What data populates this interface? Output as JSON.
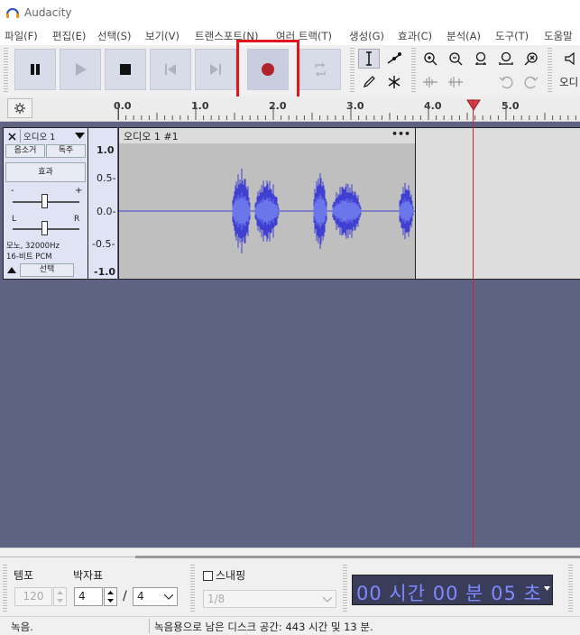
{
  "window": {
    "title": "Audacity"
  },
  "menu": [
    "파일(F)",
    "편집(E)",
    "선택(S)",
    "보기(V)",
    "트랜스포트(N)",
    "여러 트랙(T)",
    "생성(G)",
    "효과(C)",
    "분석(A)",
    "도구(T)",
    "도움말"
  ],
  "toolbar": {
    "transport": [
      {
        "name": "pause",
        "enabled": true
      },
      {
        "name": "play",
        "enabled": false
      },
      {
        "name": "stop",
        "enabled": true
      },
      {
        "name": "skip-to-start",
        "enabled": false
      },
      {
        "name": "skip-to-end",
        "enabled": false
      },
      {
        "name": "record",
        "enabled": true,
        "highlighted": true
      },
      {
        "name": "loop",
        "enabled": false
      }
    ],
    "right_label": "오디"
  },
  "timeline": {
    "labels": [
      "0.0",
      "1.0",
      "2.0",
      "3.0",
      "4.0",
      "5.0"
    ],
    "playhead_seconds": 4.6
  },
  "track": {
    "name": "오디오 1",
    "mute_label": "음소거",
    "solo_label": "독주",
    "effects_label": "효과",
    "gain_min": "-",
    "gain_max": "+",
    "pan_left": "L",
    "pan_right": "R",
    "info_line1": "모노, 32000Hz",
    "info_line2": "16-비트 PCM",
    "select_label": "선택",
    "scale": [
      "1.0",
      "0.5-",
      "0.0-",
      "-0.5-",
      "-1.0"
    ],
    "clip_name": "오디오 1 #1",
    "clip_menu": "•••"
  },
  "bottom": {
    "tempo_label": "템포",
    "tempo_value": "120",
    "timesig_label": "박자표",
    "timesig_num": "4",
    "timesig_sep": "/",
    "timesig_den": "4",
    "snap_label": "스내핑",
    "snap_value": "1/8",
    "time_display": "00 시간 00 분 05 초"
  },
  "status": {
    "left": "녹음.",
    "right": "녹음용으로 남은 디스크 공간: 443 시간 및 13 분."
  },
  "colors": {
    "waveform": "#3f3fd2",
    "waveform_rms": "#6b76ea",
    "record_dot": "#b0232b",
    "highlight": "#e4141b",
    "track_bg": "#5f6383",
    "playhead": "#c8272d"
  }
}
